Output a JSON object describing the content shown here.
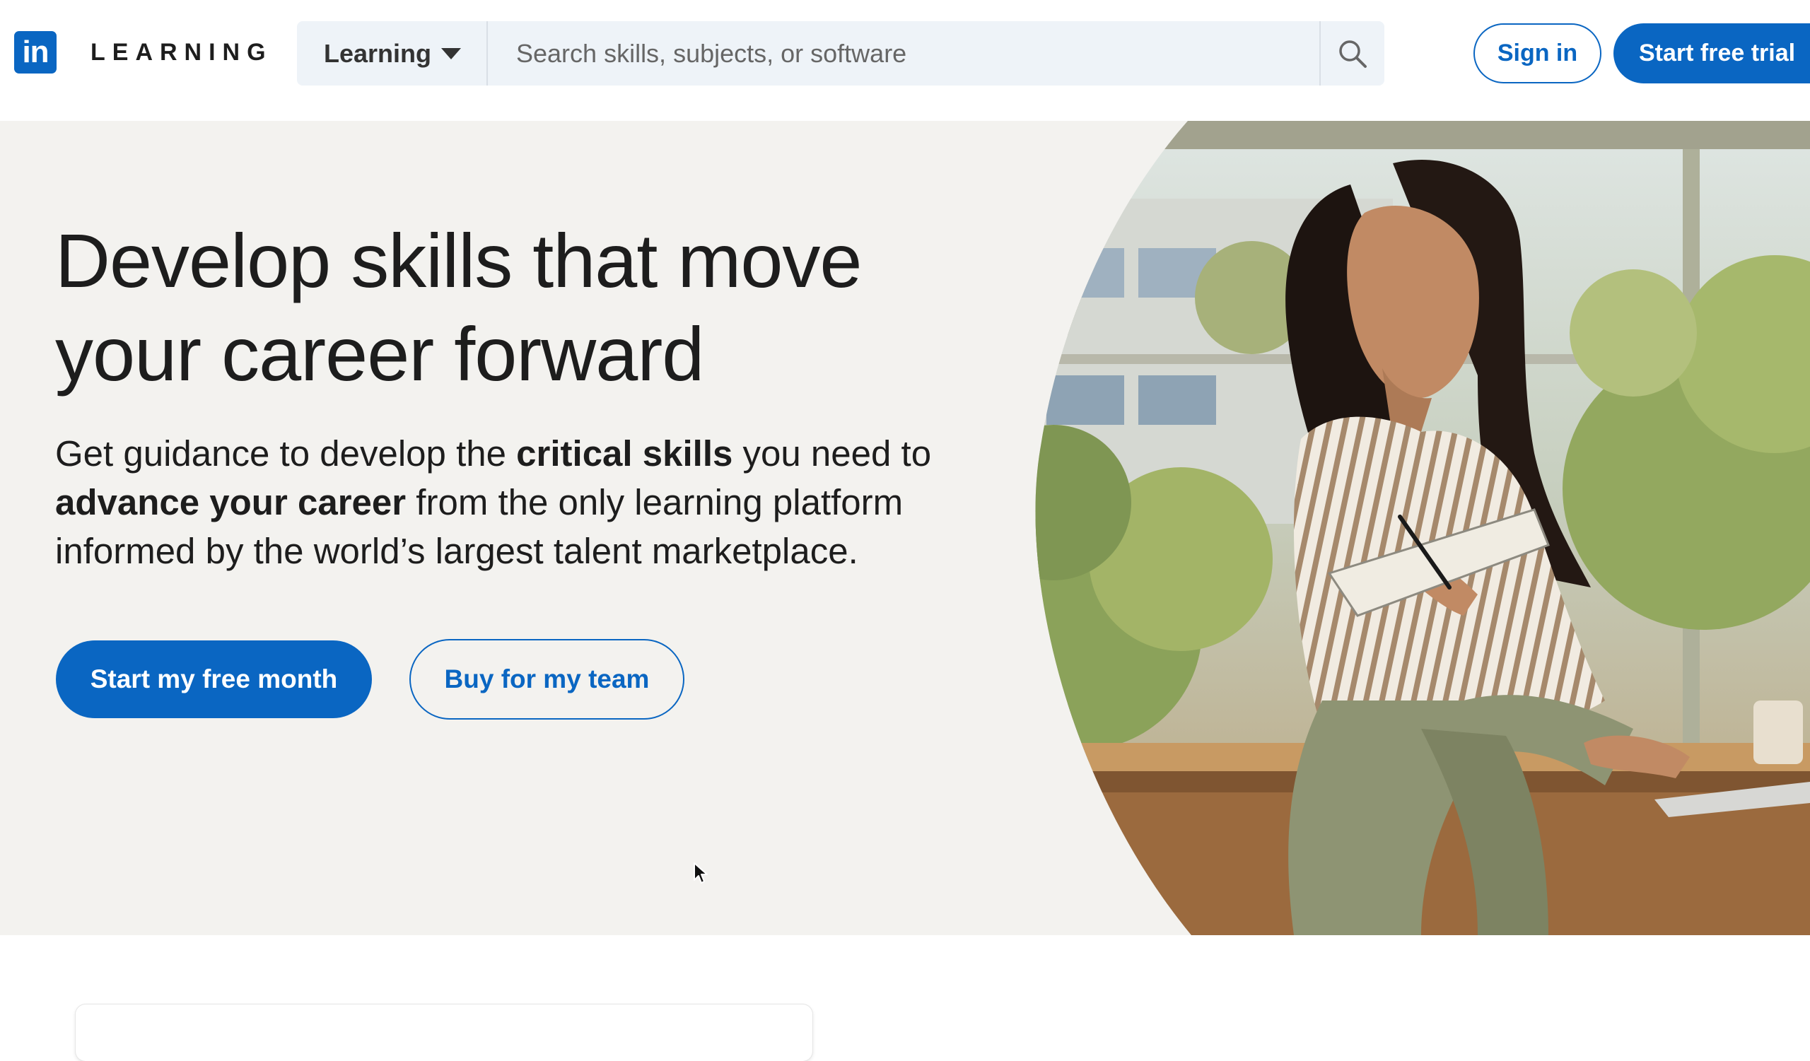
{
  "brand": {
    "logo_letters": "in",
    "wordmark": "LEARNING",
    "accent_color": "#0a66c2",
    "hero_bg_color": "#f3f2ef"
  },
  "header": {
    "search": {
      "category_label": "Learning",
      "placeholder": "Search skills, subjects, or software",
      "value": ""
    },
    "sign_in_label": "Sign in",
    "start_trial_label": "Start free trial"
  },
  "hero": {
    "title_line1": "Develop skills that move",
    "title_line2": "your career forward",
    "sub": {
      "p1": "Get guidance to develop the ",
      "b1": "critical skills",
      "p2": " you need to ",
      "b2": "advance your career",
      "p3": " from the only learning platform informed by the world’s largest talent marketplace."
    },
    "primary_cta": "Start my free month",
    "secondary_cta": "Buy for my team",
    "image": "woman-writing-in-notebook-photo"
  }
}
